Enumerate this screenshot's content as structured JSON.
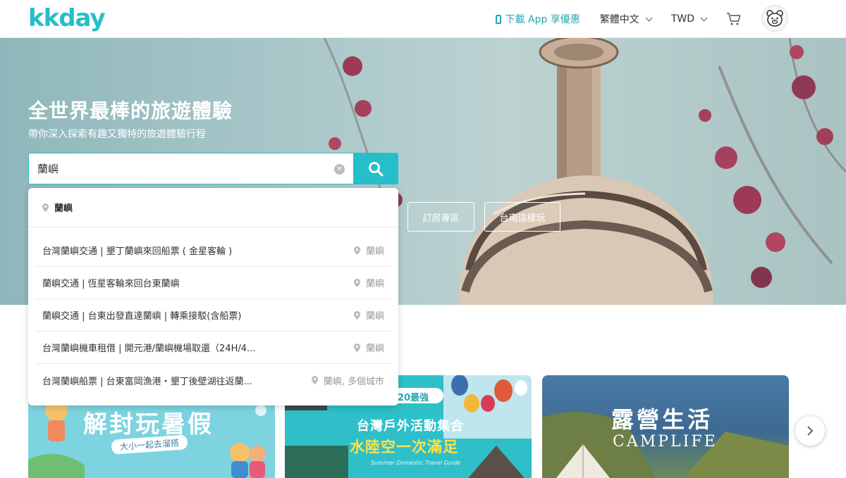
{
  "header": {
    "logo": "kkday",
    "app_link": "下載 App 享優惠",
    "language": "繁體中文",
    "currency": "TWD",
    "icons": {
      "app": "phone-icon",
      "cart": "cart-icon",
      "avatar": "bear-avatar-icon"
    }
  },
  "hero": {
    "title": "全世界最棒的旅遊體驗",
    "subtitle": "帶你深入探索有趣又獨特的旅遊體驗行程",
    "buttons": [
      "訂房專區",
      "台南這樣玩"
    ]
  },
  "search": {
    "value": "蘭嶼",
    "placeholder": ""
  },
  "dropdown": {
    "top_suggestion": "蘭嶼",
    "items": [
      {
        "name": "台灣蘭嶼交通 | 墾丁蘭嶼來回船票 ( 金星客輪 )",
        "location": "蘭嶼"
      },
      {
        "name": "蘭嶼交通 | 恆星客輪來回台東蘭嶼",
        "location": "蘭嶼"
      },
      {
        "name": "蘭嶼交通 | 台東出發直達蘭嶼 | 轉乘接駁(含船票)",
        "location": "蘭嶼"
      },
      {
        "name": "台灣蘭嶼機車租借 | 開元港/蘭嶼機場取還（24H/4...",
        "location": "蘭嶼"
      },
      {
        "name": "台灣蘭嶼船票 | 台東富岡漁港・墾丁後壁湖往返蘭...",
        "location": "蘭嶼, 多個城市"
      }
    ]
  },
  "cards": [
    {
      "title": "解封玩暑假",
      "subtitle": "大小一起去溜搭",
      "color": "#7dd3df"
    },
    {
      "title": "台灣戶外活動集合",
      "subtitle": "水陸空一次滿足",
      "badge": "20最強",
      "footer": "Summer Domestic Travel Guide",
      "color": "#2fbfc8"
    },
    {
      "title": "露營生活",
      "subtitle": "CAMPLIFE"
    }
  ],
  "colors": {
    "brand": "#26bec9",
    "text": "#333333",
    "muted": "#999999"
  }
}
